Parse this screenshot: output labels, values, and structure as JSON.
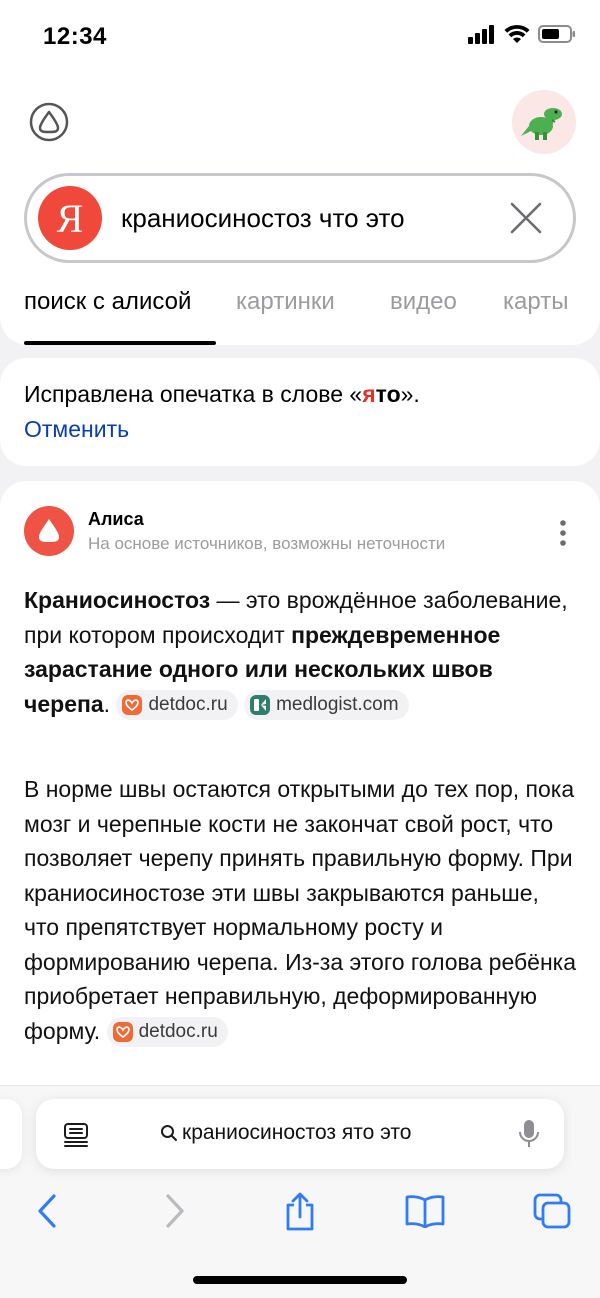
{
  "status_bar": {
    "time": "12:34"
  },
  "search": {
    "logo_letter": "Я",
    "query": "краниосиностоз что это"
  },
  "tabs": [
    {
      "label": "поиск с алисой",
      "active": true
    },
    {
      "label": "картинки",
      "active": false
    },
    {
      "label": "видео",
      "active": false
    },
    {
      "label": "карты",
      "active": false
    }
  ],
  "typo_notice": {
    "prefix": "Исправлена опечатка в слове «",
    "word_part1": "я",
    "word_part2": "то",
    "suffix": "».",
    "cancel_label": "Отменить"
  },
  "answer": {
    "author": "Алиса",
    "subtitle": "На основе источников, возможны неточности",
    "p1_term": "Краниосиностоз",
    "p1_text1": " — это врождённое заболевание, при котором происходит ",
    "p1_bold": "преждевременное зарастание одного или нескольких швов черепа",
    "p1_text2": ".",
    "source1": "detdoc.ru",
    "source2": "medlogist.com",
    "p2_text": "В норме швы остаются открытыми до тех пор, пока мозг и черепные кости не закончат свой рост, что позволяет черепу принять правильную форму. При краниосиностозе эти швы закрываются раньше, что препятствует нормальному росту и формированию черепа. Из-за этого голова ребёнка приобретает неправильную, деформированную форму.",
    "source3": "detdoc.ru"
  },
  "browser": {
    "url_text": "краниосиностоз ято это"
  },
  "colors": {
    "yandex_red": "#f0493b",
    "link_blue": "#0a3db3",
    "ios_blue": "#2f7cf6",
    "highlight_red": "#e4322b"
  },
  "icons": {
    "alice": "alice-icon",
    "avatar": "dinosaur-avatar",
    "clear": "close-icon",
    "more": "more-vertical-icon",
    "reader": "reader-icon",
    "search": "search-icon",
    "mic": "microphone-icon",
    "back": "chevron-left-icon",
    "forward": "chevron-right-icon",
    "share": "share-icon",
    "bookmarks": "book-icon",
    "tabs": "tabs-icon"
  }
}
